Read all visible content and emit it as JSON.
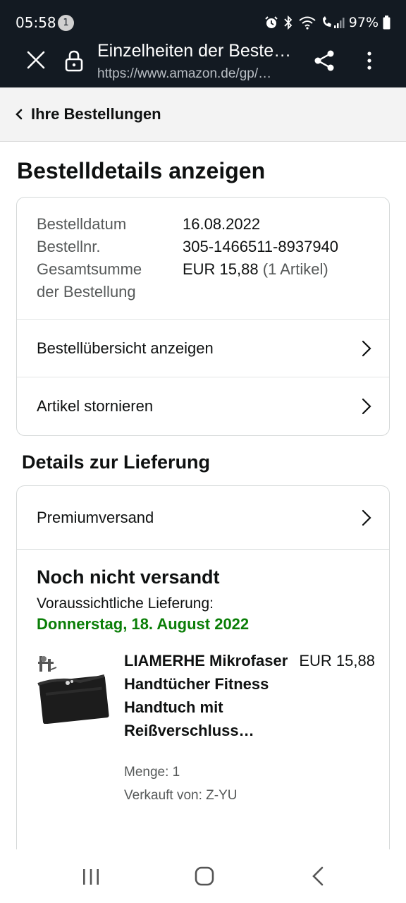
{
  "status_bar": {
    "time": "05:58",
    "notification_count": "1",
    "battery": "97%"
  },
  "browser": {
    "title": "Einzelheiten der Beste…",
    "url": "https://www.amazon.de/gp/…"
  },
  "breadcrumb": {
    "label": "Ihre Bestellungen"
  },
  "page": {
    "headline": "Bestelldetails anzeigen"
  },
  "order": {
    "date_label": "Bestelldatum",
    "date_value": "16.08.2022",
    "number_label": "Bestellnr.",
    "number_value": "305-1466511-8937940",
    "total_label_line1": "Gesamtsumme",
    "total_label_line2": "der Bestellung",
    "total_value": "EUR 15,88",
    "total_items": "(1 Artikel)",
    "links": [
      {
        "label": "Bestellübersicht anzeigen"
      },
      {
        "label": "Artikel stornieren"
      }
    ]
  },
  "delivery": {
    "section_title": "Details zur Lieferung",
    "shipping_method": "Premiumversand",
    "status": "Noch nicht versandt",
    "expected_label": "Voraussichtliche Lieferung:",
    "expected_date": "Donnerstag, 18. August 2022",
    "item": {
      "title": "LIAMERHE Mikrofaser Handtücher Fitness Handtuch mit Reißverschluss…",
      "price": "EUR 15,88",
      "quantity": "Menge: 1",
      "seller": "Verkauft von: Z-YU"
    }
  },
  "colors": {
    "top_bar": "#131a22",
    "delivery_date": "#0a7e07",
    "breadcrumb_bg": "#f3f3f3"
  }
}
